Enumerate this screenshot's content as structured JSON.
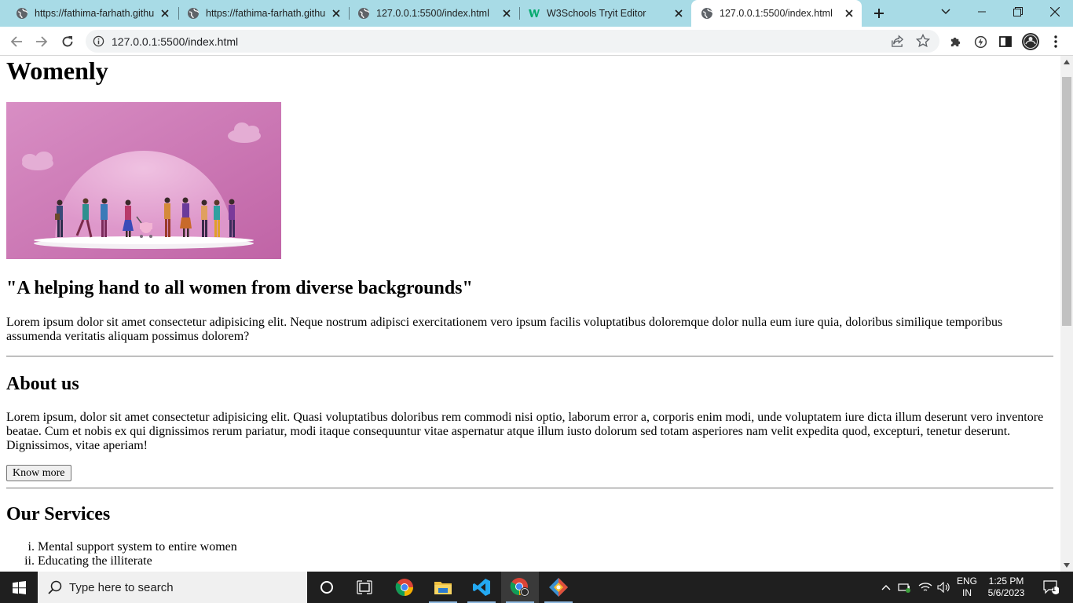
{
  "browser": {
    "tabs": [
      {
        "title": "https://fathima-farhath.githu",
        "favicon": "globe-icon",
        "active": false
      },
      {
        "title": "https://fathima-farhath.githu",
        "favicon": "globe-icon",
        "active": false
      },
      {
        "title": "127.0.0.1:5500/index.html",
        "favicon": "globe-icon",
        "active": false
      },
      {
        "title": "W3Schools Tryit Editor",
        "favicon": "w3schools-icon",
        "active": false
      },
      {
        "title": "127.0.0.1:5500/index.html",
        "favicon": "globe-icon",
        "active": true
      }
    ],
    "address": "127.0.0.1:5500/index.html",
    "colors": {
      "tabstrip": "#a8dbe6",
      "omnibox": "#f1f3f4"
    }
  },
  "page": {
    "title": "Womenly",
    "hero_image_alt": "Illustration of a group of women",
    "tagline": "\"A helping hand to all women from diverse backgrounds\"",
    "intro": "Lorem ipsum dolor sit amet consectetur adipisicing elit. Neque nostrum adipisci exercitationem vero ipsum facilis voluptatibus doloremque dolor nulla eum iure quia, doloribus similique temporibus assumenda veritatis aliquam possimus dolorem?",
    "about": {
      "heading": "About us",
      "text": "Lorem ipsum, dolor sit amet consectetur adipisicing elit. Quasi voluptatibus doloribus rem commodi nisi optio, laborum error a, corporis enim modi, unde voluptatem iure dicta illum deserunt vero inventore beatae. Cum et nobis ex qui dignissimos rerum pariatur, modi itaque consequuntur vitae aspernatur atque illum iusto dolorum sed totam asperiores nam velit expedita quod, excepturi, tenetur deserunt. Dignissimos, vitae aperiam!",
      "button": "Know more"
    },
    "services": {
      "heading": "Our Services",
      "items": [
        {
          "num": "i.",
          "text": "Mental support system to entire women"
        },
        {
          "num": "ii.",
          "text": "Educating the illiterate"
        }
      ]
    }
  },
  "taskbar": {
    "search_placeholder": "Type here to search",
    "language": {
      "line1": "ENG",
      "line2": "IN"
    },
    "time": "1:25 PM",
    "date": "5/6/2023",
    "notification_count": "1"
  }
}
